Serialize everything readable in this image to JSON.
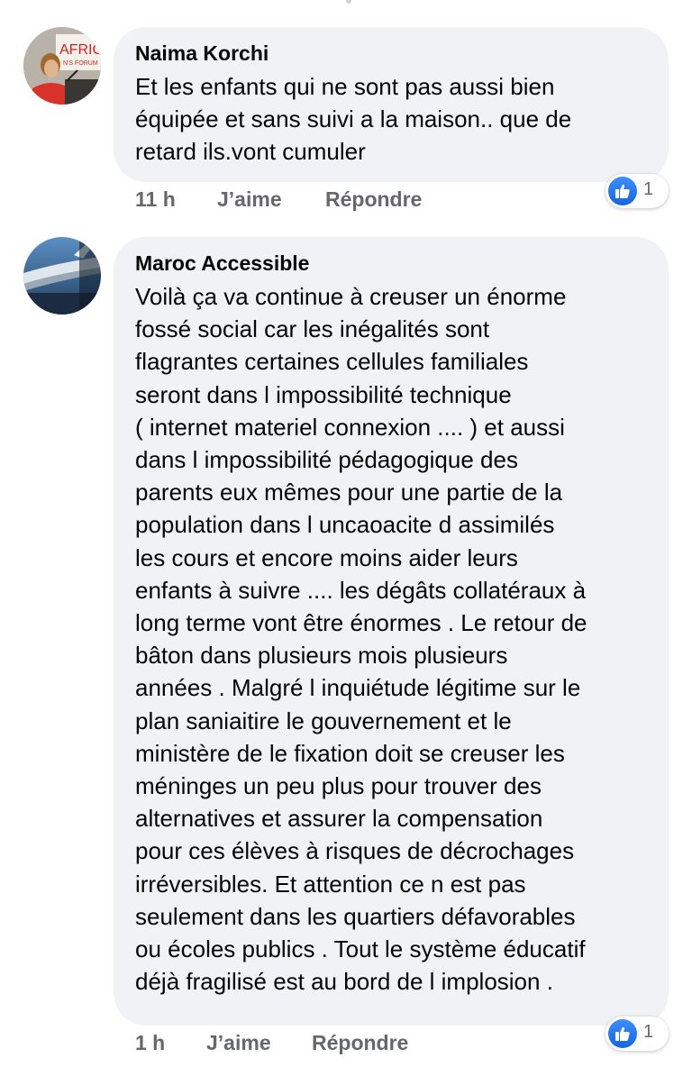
{
  "colors": {
    "bubble": "#f0f2f5",
    "meta_text": "#65676b",
    "like_blue": "#1877f2"
  },
  "comments": [
    {
      "author": "Naima Korchi",
      "avatar_icon": "profile-photo-speaker-at-podium",
      "avatar_badge_text": [
        "AFRICA",
        "N'S FORUM"
      ],
      "text_lines": [
        "Et les enfants qui ne sont pas aussi bien",
        "équipée et sans suivi a la maison.. que de",
        "retard ils.vont cumuler"
      ],
      "time": "11 h",
      "like_label": "J’aime",
      "reply_label": "Répondre",
      "reaction_icon": "like-icon",
      "reaction_count": "1"
    },
    {
      "author": "Maroc Accessible",
      "avatar_icon": "profile-photo-airplane-wing-sky",
      "text_lines": [
        "Voilà ça va continue à creuser un énorme",
        "fossé social car les inégalités sont",
        "flagrantes certaines cellules familiales",
        "seront dans l impossibilité technique",
        "( internet materiel connexion .... ) et aussi",
        "dans l impossibilité pédagogique des",
        "parents eux mêmes pour une partie de la",
        "population dans l uncaoacite d assimilés",
        "les cours et encore moins aider leurs",
        "enfants à suivre .... les dégâts collatéraux à",
        "long terme vont être énormes . Le retour de",
        "bâton dans plusieurs mois plusieurs",
        "années . Malgré l inquiétude légitime sur le",
        "plan saniaitire le gouvernement et le",
        "ministère de le fixation doit se creuser les",
        "méninges un peu plus pour trouver des",
        "alternatives et assurer la compensation",
        "pour ces élèves à risques de décrochages",
        "irréversibles. Et attention ce n est pas",
        "seulement dans les quartiers défavorables",
        "ou écoles publics . Tout le système éducatif",
        "déjà fragilisé est au bord de l implosion ."
      ],
      "time": "1 h",
      "like_label": "J’aime",
      "reply_label": "Répondre",
      "reaction_icon": "like-icon",
      "reaction_count": "1"
    }
  ]
}
